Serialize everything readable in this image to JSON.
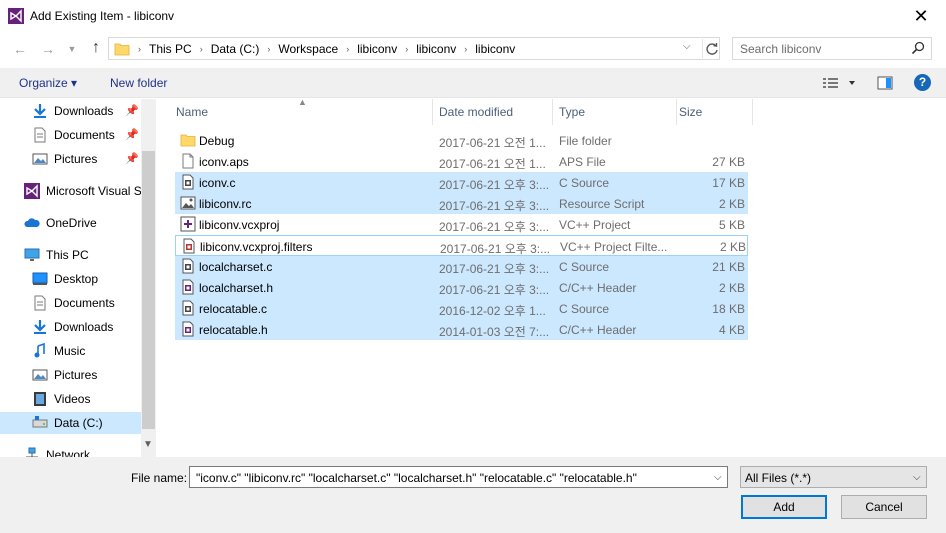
{
  "window": {
    "title": "Add Existing Item - libiconv",
    "close_glyph": "✕"
  },
  "address": {
    "segments": [
      "This PC",
      "Data (C:)",
      "Workspace",
      "libiconv",
      "libiconv",
      "libiconv"
    ]
  },
  "search": {
    "placeholder": "Search libiconv"
  },
  "toolbar": {
    "organize": "Organize ▾",
    "new_folder": "New folder",
    "help": "?"
  },
  "nav": [
    {
      "label": "Downloads",
      "icon": "download-arrow-icon",
      "pinned": true
    },
    {
      "label": "Documents",
      "icon": "document-icon",
      "pinned": true
    },
    {
      "label": "Pictures",
      "icon": "picture-icon",
      "pinned": true
    },
    {
      "label": "Microsoft Visual S",
      "icon": "visual-studio-icon",
      "pinned": false
    },
    {
      "label": "OneDrive",
      "icon": "cloud-icon",
      "pinned": false
    },
    {
      "label": "This PC",
      "icon": "computer-icon",
      "pinned": false
    },
    {
      "label": "Desktop",
      "icon": "desktop-icon",
      "pinned": false
    },
    {
      "label": "Documents",
      "icon": "document-icon",
      "pinned": false
    },
    {
      "label": "Downloads",
      "icon": "download-arrow-icon",
      "pinned": false
    },
    {
      "label": "Music",
      "icon": "music-note-icon",
      "pinned": false
    },
    {
      "label": "Pictures",
      "icon": "picture-icon",
      "pinned": false
    },
    {
      "label": "Videos",
      "icon": "film-icon",
      "pinned": false
    },
    {
      "label": "Data (C:)",
      "icon": "drive-icon",
      "pinned": false,
      "selected": true
    },
    {
      "label": "Network",
      "icon": "network-icon",
      "pinned": false
    }
  ],
  "columns": {
    "name": "Name",
    "date": "Date modified",
    "type": "Type",
    "size": "Size"
  },
  "files": [
    {
      "name": "Debug",
      "date": "2017-06-21 오전 1...",
      "type": "File folder",
      "size": "",
      "icon": "folder-icon",
      "state": "normal"
    },
    {
      "name": "iconv.aps",
      "date": "2017-06-21 오전 1...",
      "type": "APS File",
      "size": "27 KB",
      "icon": "blank-file-icon",
      "state": "normal"
    },
    {
      "name": "iconv.c",
      "date": "2017-06-21 오후 3:...",
      "type": "C Source",
      "size": "17 KB",
      "icon": "c-source-icon",
      "state": "selected"
    },
    {
      "name": "libiconv.rc",
      "date": "2017-06-21 오후 3:...",
      "type": "Resource Script",
      "size": "2 KB",
      "icon": "resource-script-icon",
      "state": "selected"
    },
    {
      "name": "libiconv.vcxproj",
      "date": "2017-06-21 오후 3:...",
      "type": "VC++ Project",
      "size": "5 KB",
      "icon": "vcxproj-icon",
      "state": "normal"
    },
    {
      "name": "libiconv.vcxproj.filters",
      "date": "2017-06-21 오후 3:...",
      "type": "VC++ Project Filte...",
      "size": "2 KB",
      "icon": "filters-file-icon",
      "state": "focus"
    },
    {
      "name": "localcharset.c",
      "date": "2017-06-21 오후 3:...",
      "type": "C Source",
      "size": "21 KB",
      "icon": "c-source-icon",
      "state": "selected"
    },
    {
      "name": "localcharset.h",
      "date": "2017-06-21 오후 3:...",
      "type": "C/C++ Header",
      "size": "2 KB",
      "icon": "header-file-icon",
      "state": "selected"
    },
    {
      "name": "relocatable.c",
      "date": "2016-12-02 오후 1...",
      "type": "C Source",
      "size": "18 KB",
      "icon": "c-source-icon",
      "state": "selected"
    },
    {
      "name": "relocatable.h",
      "date": "2014-01-03 오전 7:...",
      "type": "C/C++ Header",
      "size": "4 KB",
      "icon": "header-file-icon",
      "state": "selected"
    }
  ],
  "footer": {
    "file_name_label": "File name:",
    "file_name_value": "\"iconv.c\" \"libiconv.rc\" \"localcharset.c\" \"localcharset.h\" \"relocatable.c\" \"relocatable.h\"",
    "filter_value": "All Files (*.*)",
    "add_label": "Add",
    "cancel_label": "Cancel"
  }
}
